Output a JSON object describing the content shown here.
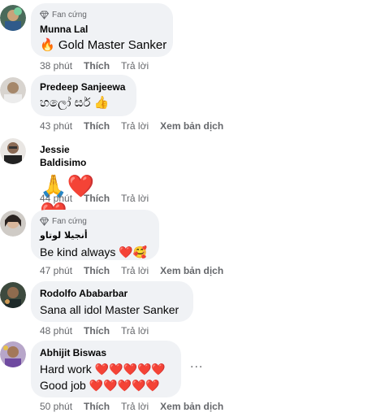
{
  "comments": [
    {
      "badge": "Fan cứng",
      "name": "Munna Lal",
      "text": "🔥 Gold Master Sanker",
      "time": "38 phút",
      "like": "Thích",
      "reply": "Trả lời"
    },
    {
      "name": "Predeep Sanjeewa",
      "text": "හලෝ සර් 👍",
      "time": "43 phút",
      "like": "Thích",
      "reply": "Trả lời",
      "translate": "Xem bản dịch"
    },
    {
      "name": "Jessie Baldisimo",
      "text": "🙏❤️❤️",
      "time": "44 phút",
      "like": "Thích",
      "reply": "Trả lời"
    },
    {
      "badge": "Fan cứng",
      "name": "أنجيلا لوتاو",
      "text": "Be kind always ❤️🥰",
      "time": "47 phút",
      "like": "Thích",
      "reply": "Trả lời",
      "translate": "Xem bản dịch"
    },
    {
      "name": "Rodolfo Ababarbar",
      "text": "Sana all idol Master Sanker",
      "time": "48 phút",
      "like": "Thích",
      "reply": "Trả lời"
    },
    {
      "name": "Abhijit Biswas",
      "text_line1": "Hard work ❤️❤️❤️❤️❤️",
      "text_line2": "Good job ❤️❤️❤️❤️❤️",
      "time": "50 phút",
      "like": "Thích",
      "reply": "Trả lời",
      "translate": "Xem bản dịch",
      "more": "..."
    }
  ],
  "colors": {
    "bubble": "#f0f2f5",
    "meta": "#65676b",
    "heart": "#e41e3f"
  }
}
